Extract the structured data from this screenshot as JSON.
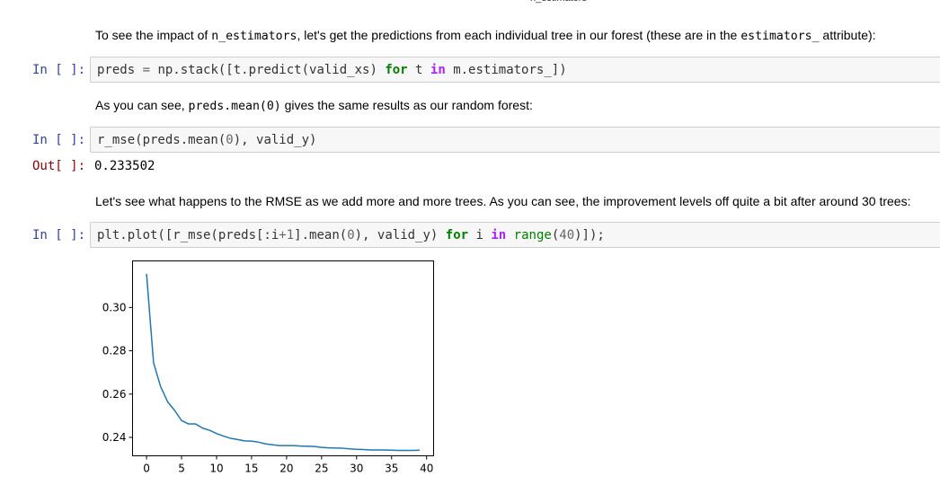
{
  "header_fragment": "n_estimators",
  "cells": {
    "md1": {
      "before": "To see the impact of ",
      "code1": "n_estimators",
      "middle": ", let's get the predictions from each individual tree in our forest (these are in the ",
      "code2": "estimators_",
      "after": " attribute):"
    },
    "in1": {
      "prompt": "In [ ]:",
      "code": {
        "t1": "preds ",
        "t2": "=",
        "t3": " np.stack([t.predict(valid_xs) ",
        "t4": "for",
        "t5": " t ",
        "t6": "in",
        "t7": " m.estimators_])"
      }
    },
    "md2": {
      "before": "As you can see, ",
      "code1": "preds.mean(0)",
      "after": " gives the same results as our random forest:"
    },
    "in2": {
      "prompt": "In [ ]:",
      "code": {
        "t1": "r_mse(preds.mean(",
        "t2": "0",
        "t3": "), valid_y)"
      }
    },
    "out2": {
      "prompt": "Out[ ]:",
      "value": "0.233502"
    },
    "md3": {
      "text": "Let's see what happens to the RMSE as we add more and more trees. As you can see, the improvement levels off quite a bit after around 30 trees:"
    },
    "in3": {
      "prompt": "In [ ]:",
      "code": {
        "t1": "plt.plot([r_mse(preds[:i",
        "t2": "+",
        "t3": "1",
        "t4": "].mean(",
        "t5": "0",
        "t6": "), valid_y) ",
        "t7": "for",
        "t8": " i ",
        "t9": "in",
        "t10": " ",
        "t11": "range",
        "t12": "(",
        "t13": "40",
        "t14": ")]);"
      }
    }
  },
  "chart_data": {
    "type": "line",
    "title": "",
    "xlabel": "",
    "ylabel": "",
    "xlim": [
      -2,
      41
    ],
    "ylim": [
      0.2315,
      0.3215
    ],
    "xticks": [
      0,
      5,
      10,
      15,
      20,
      25,
      30,
      35,
      40
    ],
    "yticks": [
      0.24,
      0.26,
      0.28,
      0.3
    ],
    "ytick_labels": [
      "0.24",
      "0.26",
      "0.28",
      "0.30"
    ],
    "grid": false,
    "series": [
      {
        "color": "#1f77b4",
        "x": [
          0,
          1,
          2,
          3,
          4,
          5,
          6,
          7,
          8,
          9,
          10,
          11,
          12,
          13,
          14,
          15,
          16,
          17,
          18,
          19,
          20,
          21,
          22,
          23,
          24,
          25,
          26,
          27,
          28,
          29,
          30,
          31,
          32,
          33,
          34,
          35,
          36,
          37,
          38,
          39
        ],
        "values": [
          0.3155,
          0.2745,
          0.2635,
          0.2565,
          0.2525,
          0.2478,
          0.2462,
          0.2462,
          0.2443,
          0.2433,
          0.2418,
          0.2406,
          0.2396,
          0.239,
          0.2384,
          0.2383,
          0.2378,
          0.237,
          0.2366,
          0.2362,
          0.2362,
          0.2362,
          0.236,
          0.2359,
          0.2358,
          0.2354,
          0.2352,
          0.2351,
          0.235,
          0.2347,
          0.2345,
          0.2344,
          0.2342,
          0.2342,
          0.2342,
          0.2341,
          0.234,
          0.234,
          0.234,
          0.2341
        ]
      }
    ]
  }
}
